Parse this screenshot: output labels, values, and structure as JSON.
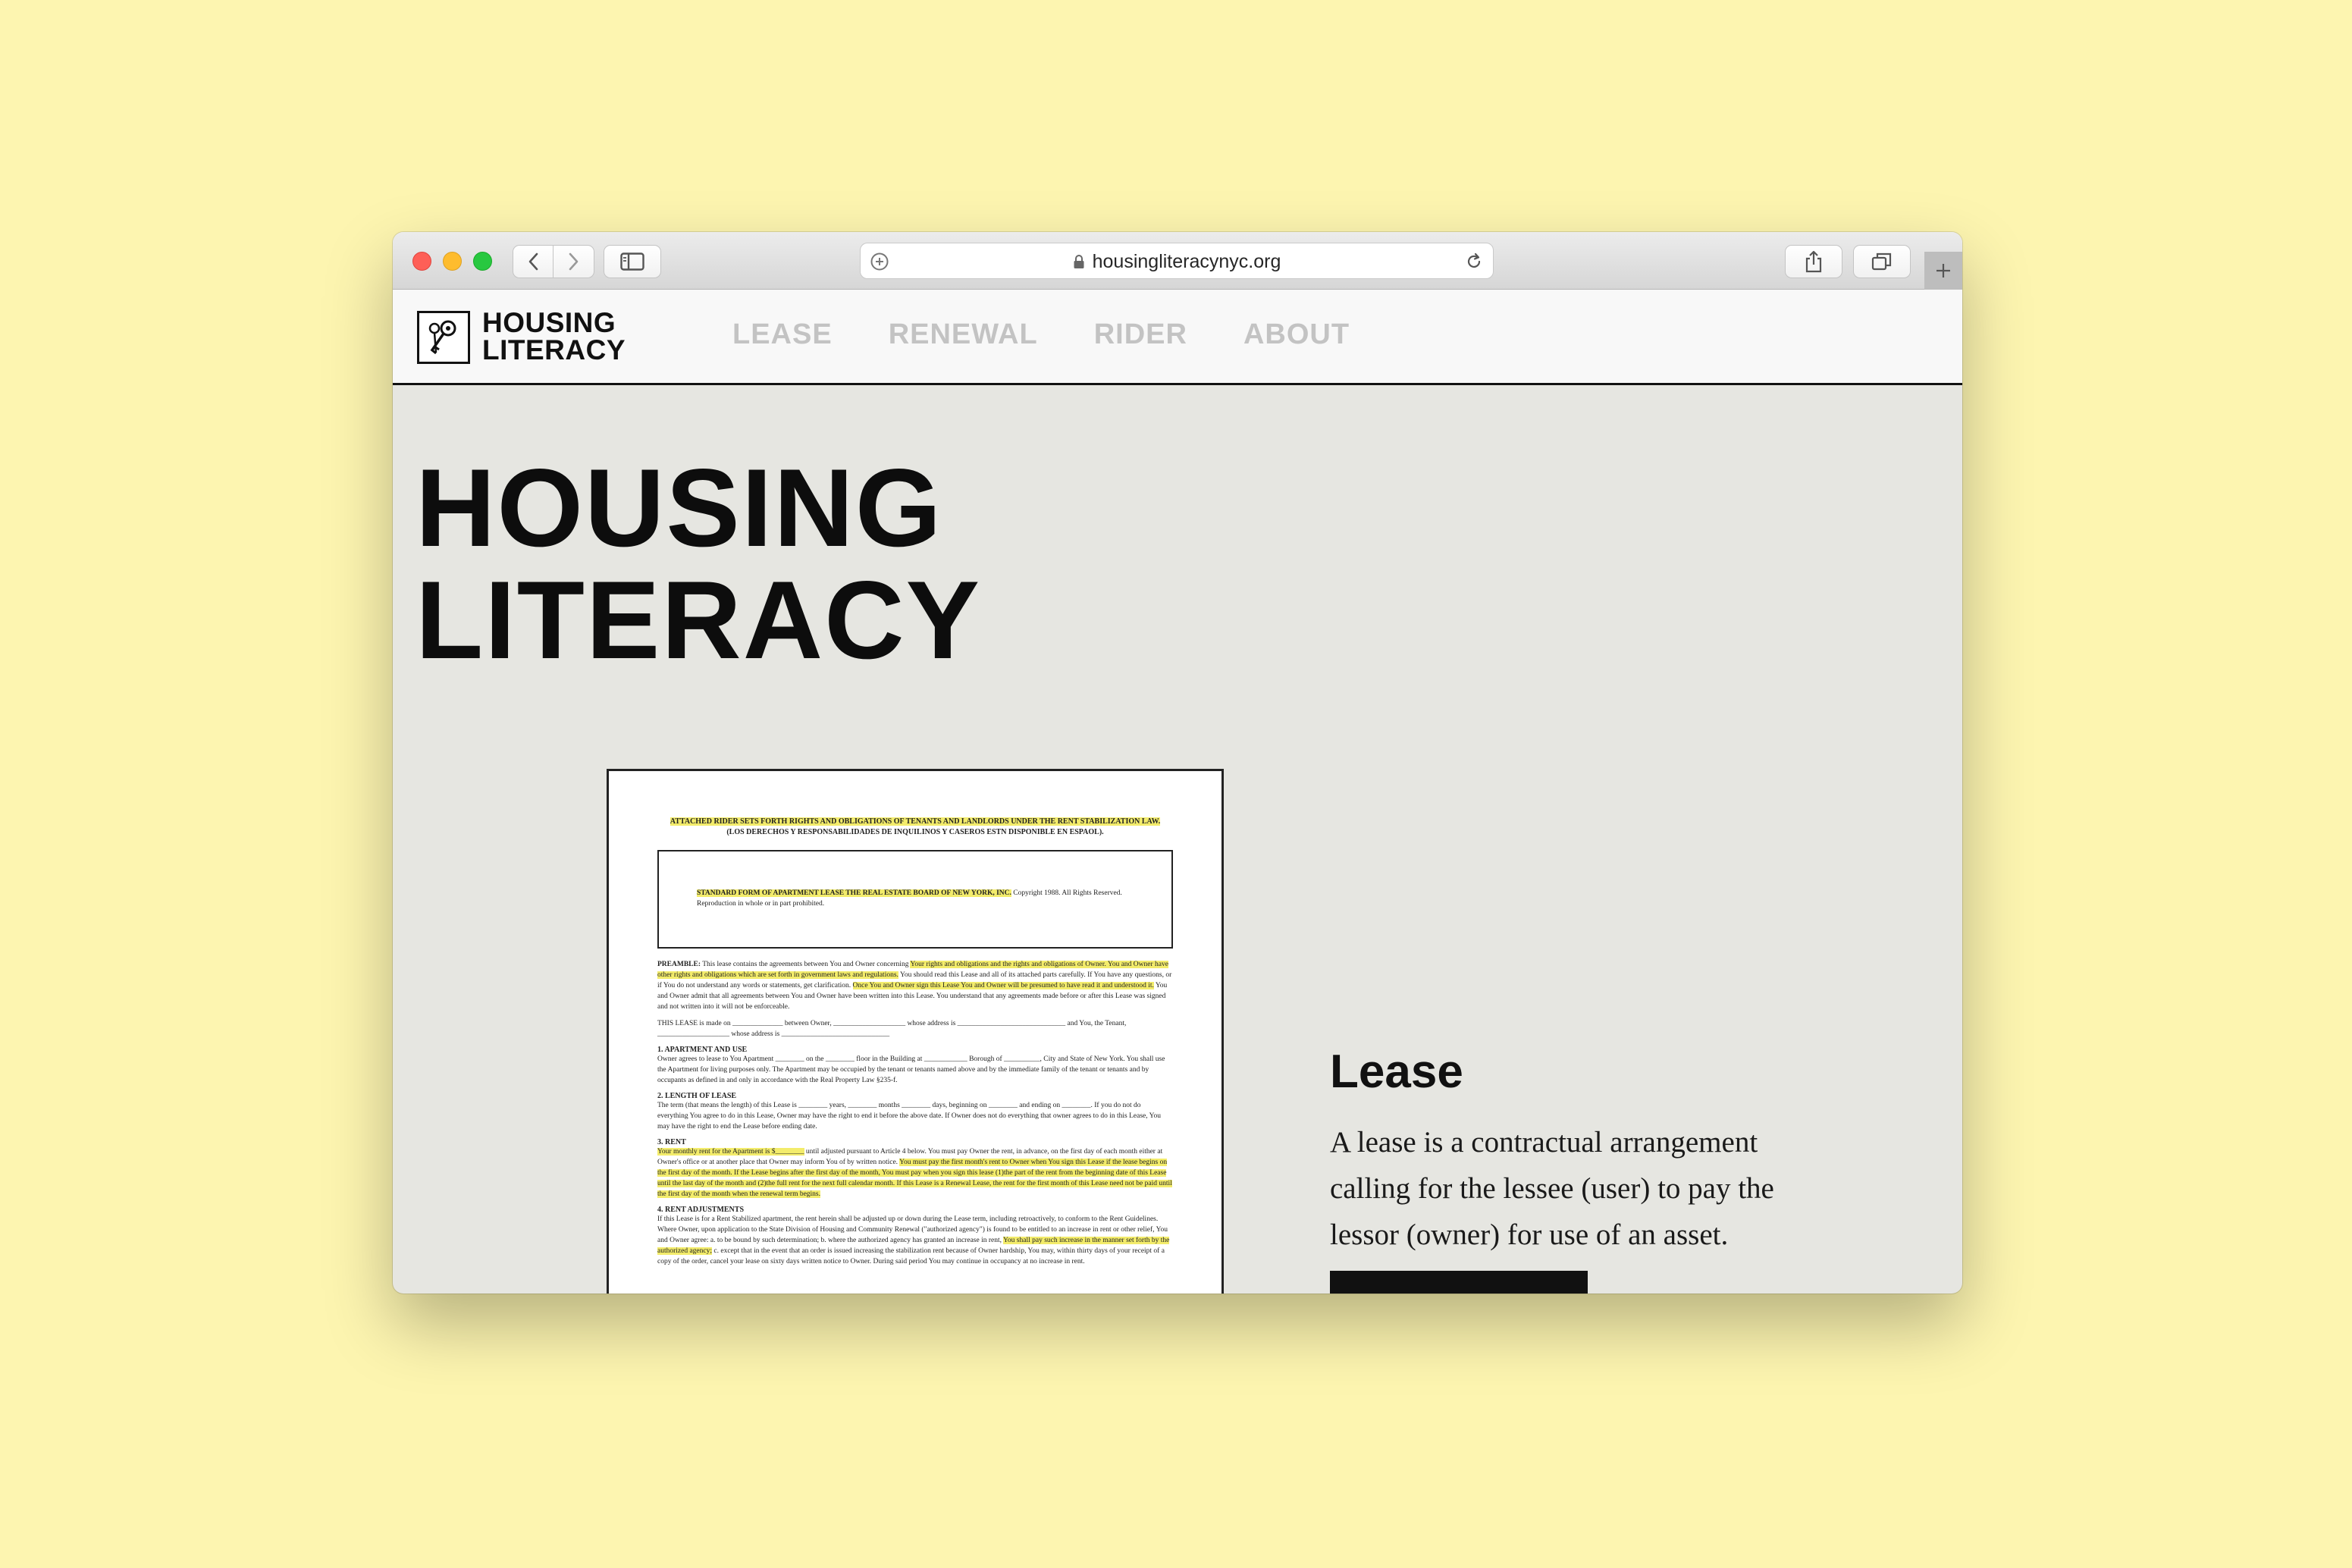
{
  "browser": {
    "url": "housingliteracynyc.org"
  },
  "site": {
    "logo_line1": "HOUSING",
    "logo_line2": "LITERACY",
    "nav": [
      {
        "label": "LEASE"
      },
      {
        "label": "RENEWAL"
      },
      {
        "label": "RIDER"
      },
      {
        "label": "ABOUT"
      }
    ]
  },
  "hero": {
    "line1": "HOUSING",
    "line2": "LITERACY"
  },
  "document": {
    "header1": "ATTACHED RIDER SETS FORTH RIGHTS AND OBLIGATIONS OF TENANTS AND LANDLORDS UNDER THE RENT STABILIZATION LAW.",
    "header2": "(LOS DERECHOS Y RESPONSABILIDADES DE INQUILINOS Y CASEROS ESTN DISPONIBLE EN ESPAOL).",
    "box_bold": "STANDARD FORM OF APARTMENT LEASE THE REAL ESTATE BOARD OF NEW YORK, INC.",
    "box_rest": " Copyright 1988. All Rights Reserved. Reproduction in whole or in part prohibited.",
    "preamble_label": "PREAMBLE:",
    "preamble_a": " This lease contains the agreements between You and Owner concerning ",
    "preamble_hl": "Your rights and obligations and the rights and obligations of Owner. You and Owner have other rights and obligations which are set forth in government laws and regulations.",
    "preamble_b": " You should read this Lease and all of its attached parts carefully. If You have any questions, or if You do not understand any words or statements, get clarification.",
    "preamble_hl2": "Once You and Owner sign this Lease You and Owner will be presumed to have read it and understood it.",
    "preamble_c": " You and Owner admit that all agreements between You and Owner have been written into this Lease. You understand that any agreements made before or after this Lease was signed and not written into it will not be enforceable.",
    "made_on": "THIS LEASE is made on ______________ between Owner, ____________________ whose address is ______________________________ and You, the Tenant, ____________________ whose address is ______________________________",
    "sec1": "1. APARTMENT AND USE",
    "sec1_text": "Owner agrees to lease to You Apartment ________ on the ________ floor in the Building at ____________ Borough of __________, City and State of New York. You shall use the Apartment for living purposes only. The Apartment may be occupied by the tenant or tenants named above and by the immediate family of the tenant or tenants and by occupants as defined in and only in accordance with the Real Property Law §235-f.",
    "sec2": "2. LENGTH OF LEASE",
    "sec2_text": "The term (that means the length) of this Lease is ________ years, ________ months ________ days, beginning on ________ and ending on ________. If you do not do everything You agree to do in this Lease, Owner may have the right to end it before the above date. If Owner does not do everything that owner agrees to do in this Lease, You may have the right to end the Lease before ending date.",
    "sec3": "3. RENT",
    "sec3_hl": "Your monthly rent for the Apartment is $________",
    "sec3_a": " until adjusted pursuant to Article 4 below. You must pay Owner the rent, in advance, on the first day of each month either at Owner's office or at another place that Owner may inform You of by written notice. ",
    "sec3_hl2": "You must pay the first month's rent to Owner when You sign this Lease if the lease begins on the first day of the month. If the Lease begins after the first day of the month, You must pay when you sign this lease (1)the part of the rent from the beginning date of this Lease until the last day of the month and (2)the full rent for the next full calendar month. If this Lease is a Renewal Lease, the rent for the first month of this Lease need not be paid until the first day of the month when the renewal term begins.",
    "sec4": "4. RENT ADJUSTMENTS",
    "sec4_a": "If this Lease is for a Rent Stabilized apartment, the rent herein shall be adjusted up or down during the Lease term, including retroactively, to conform to the Rent Guidelines. Where Owner, upon application to the State Division of Housing and Community Renewal (\"authorized agency\") is found to be entitled to an increase in rent or other relief, You and Owner agree: a. to be bound by such determination; b. where the authorized agency has granted an increase in rent, ",
    "sec4_hl": "You shall pay such increase in the manner set forth by the authorized agency;",
    "sec4_b": " c. except that in the event that an order is issued increasing the stabilization rent because of Owner hardship, You may, within thirty days of your receipt of a copy of the order, cancel your lease on sixty days written notice to Owner. During said period You may continue in occupancy at no increase in rent."
  },
  "lease_section": {
    "heading": "Lease",
    "description": "A lease is a contractual arrangement calling for the lessee (user) to pay the lessor (owner) for use of an asset."
  },
  "colors": {
    "background": "#fdf5b0",
    "page_bg": "#e6e6e1",
    "nav_inactive": "#c3c3c3",
    "highlight": "#f3ec6b"
  },
  "icons": [
    "back-icon",
    "forward-icon",
    "sidebar-icon",
    "add-bookmark-icon",
    "lock-icon",
    "reload-icon",
    "share-icon",
    "tabs-icon",
    "new-tab-icon",
    "keys-logo-icon"
  ]
}
